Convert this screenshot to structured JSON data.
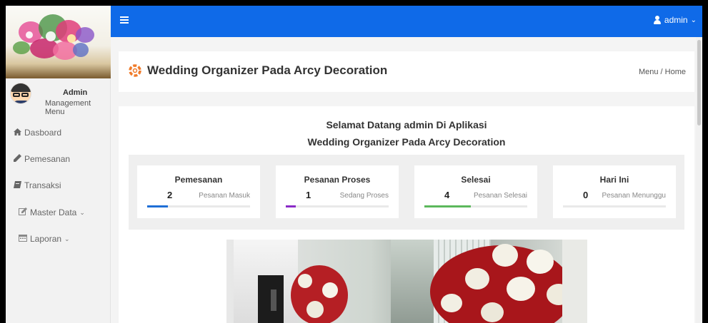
{
  "topbar": {
    "user_label": "admin"
  },
  "profile": {
    "name": "Admin",
    "role": "Management Menu"
  },
  "sidebar": {
    "items": [
      {
        "label": "Dasboard",
        "icon": "home-icon"
      },
      {
        "label": "Pemesanan",
        "icon": "pencil-icon"
      },
      {
        "label": "Transaksi",
        "icon": "book-icon"
      },
      {
        "label": "Master Data",
        "icon": "edit-icon",
        "has_dropdown": true
      },
      {
        "label": "Laporan",
        "icon": "calendar-icon",
        "has_dropdown": true
      }
    ]
  },
  "header": {
    "title": "Wedding Organizer Pada Arcy Decoration",
    "breadcrumb": "Menu / Home"
  },
  "welcome": {
    "line1": "Selamat Datang admin Di Aplikasi",
    "line2": "Wedding Organizer Pada Arcy Decoration"
  },
  "stats": [
    {
      "label": "Pemesanan",
      "value": "2",
      "caption": "Pesanan Masuk",
      "progress": 0.2,
      "color": "#1f6fd6"
    },
    {
      "label": "Pesanan Proses",
      "value": "1",
      "caption": "Sedang Proses",
      "progress": 0.1,
      "color": "#8a2bc7"
    },
    {
      "label": "Selesai",
      "value": "4",
      "caption": "Pesanan Selesai",
      "progress": 0.45,
      "color": "#5cb85c"
    },
    {
      "label": "Hari Ini",
      "value": "0",
      "caption": "Pesanan Menunggu",
      "progress": 0,
      "color": "#1f6fd6"
    }
  ],
  "colors": {
    "topbar": "#0f6ae8",
    "accent_logo": "#f07b2a"
  }
}
